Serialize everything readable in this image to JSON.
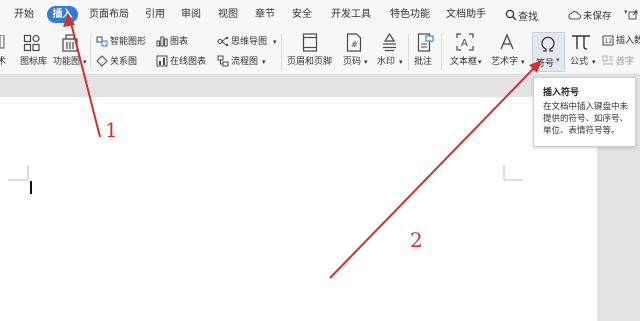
{
  "menu": {
    "items": [
      "开始",
      "插入",
      "页面布局",
      "引用",
      "审阅",
      "视图",
      "章节",
      "安全",
      "开发工具",
      "特色功能",
      "文档助手"
    ],
    "search_label": "查找",
    "unsaved_label": "未保存"
  },
  "ribbon": {
    "left_partial": "术",
    "icon_library": "图标库",
    "function_chart": "功能图",
    "smart_shape": "智能图形",
    "chart": "图表",
    "mind_map": "思维导图",
    "relation_chart": "关系图",
    "online_chart": "在线图表",
    "flowchart": "流程图",
    "header_footer": "页眉和页脚",
    "page_number": "页码",
    "watermark": "水印",
    "comment": "批注",
    "textbox": "文本框",
    "wordart": "艺术字",
    "symbol": "符号",
    "formula": "公式",
    "insert_number_partial": "插入数",
    "first_letter_partial": "首字"
  },
  "tooltip": {
    "title": "插入符号",
    "lines": [
      "在文档中插入键盘中未",
      "提供的符号、如序号、",
      "单位、表情符号等。"
    ]
  },
  "annotations": {
    "label1": "1",
    "label2": "2"
  },
  "colors": {
    "accent": "#2f7de1",
    "annotation": "#d0322d"
  }
}
